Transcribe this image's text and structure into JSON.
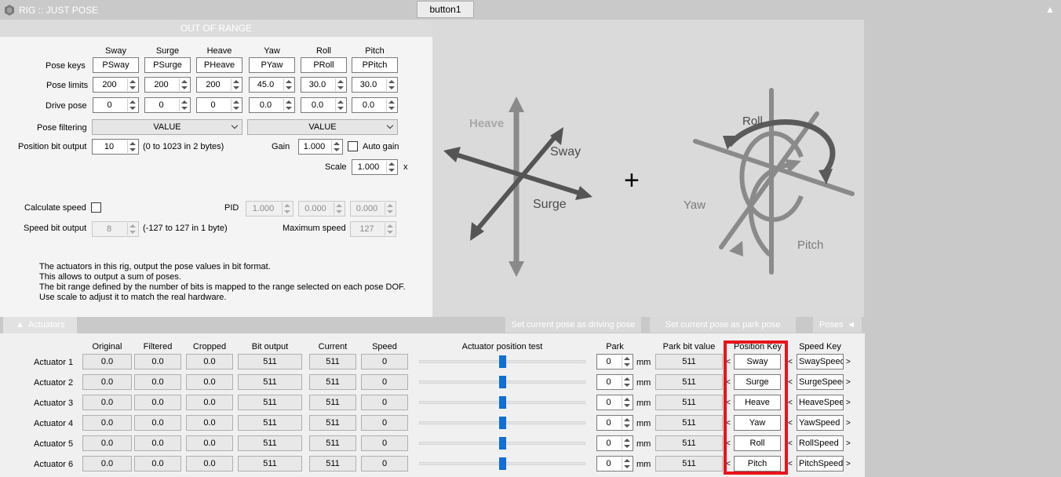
{
  "window": {
    "title": "RIG :: JUST POSE",
    "top_button": "button1"
  },
  "left": {
    "banner": "OUT OF RANGE",
    "dof_headers": [
      "Sway",
      "Surge",
      "Heave",
      "Yaw",
      "Roll",
      "Pitch"
    ],
    "row_labels": {
      "pose_keys": "Pose keys",
      "pose_limits": "Pose limits",
      "drive_pose": "Drive pose",
      "pose_filtering": "Pose filtering",
      "position_bit_output": "Position bit output"
    },
    "pose_keys": [
      "PSway",
      "PSurge",
      "PHeave",
      "PYaw",
      "PRoll",
      "PPitch"
    ],
    "pose_limits": [
      "200",
      "200",
      "200",
      "45.0",
      "30.0",
      "30.0"
    ],
    "drive_pose": [
      "0",
      "0",
      "0",
      "0.0",
      "0.0",
      "0.0"
    ],
    "filter_1": "VALUE",
    "filter_2": "VALUE",
    "position_bits": "10",
    "position_bits_note": "(0 to 1023 in 2 bytes)",
    "gain_label": "Gain",
    "gain": "1.000",
    "auto_gain_label": "Auto gain",
    "scale_label": "Scale",
    "scale": "1.000",
    "scale_unit": "x",
    "calc_speed_label": "Calculate speed",
    "pid_label": "PID",
    "pid": [
      "1.000",
      "0.000",
      "0.000"
    ],
    "speed_bit_label": "Speed bit output",
    "speed_bits": "8",
    "speed_bits_note": "(-127 to 127 in 1 byte)",
    "max_speed_label": "Maximum speed",
    "max_speed": "127",
    "description": [
      "The actuators in this rig, output the pose values in bit format.",
      "This allows to output a sum of poses.",
      "The bit range defined by the number of bits is mapped to the range selected on each pose DOF.",
      "Use scale to adjust it to match the real hardware."
    ]
  },
  "diagram": {
    "heave": "Heave",
    "sway": "Sway",
    "surge": "Surge",
    "plus": "+",
    "roll": "Roll",
    "yaw": "Yaw",
    "pitch": "Pitch"
  },
  "tabs": {
    "actuators": "Actuators",
    "set_driving": "Set current pose as driving pose",
    "set_park": "Set current pose as park pose",
    "poses": "Poses"
  },
  "actuators": {
    "headers": {
      "original": "Original",
      "filtered": "Filtered",
      "cropped": "Cropped",
      "bit_output": "Bit output",
      "current": "Current",
      "speed": "Speed",
      "position_test": "Actuator position test",
      "park": "Park",
      "park_bit": "Park bit value",
      "position_key": "Position Key",
      "speed_key": "Speed Key"
    },
    "unit": "mm",
    "lt": "<",
    "gt": ">",
    "rows": [
      {
        "name": "Actuator 1",
        "original": "0.0",
        "filtered": "0.0",
        "cropped": "0.0",
        "bit": "511",
        "current": "511",
        "speed": "0",
        "park": "0",
        "park_bit": "511",
        "pos_key": "Sway",
        "speed_key": "SwaySpeed",
        "slider": 0.5
      },
      {
        "name": "Actuator 2",
        "original": "0.0",
        "filtered": "0.0",
        "cropped": "0.0",
        "bit": "511",
        "current": "511",
        "speed": "0",
        "park": "0",
        "park_bit": "511",
        "pos_key": "Surge",
        "speed_key": "SurgeSpeed",
        "slider": 0.5
      },
      {
        "name": "Actuator 3",
        "original": "0.0",
        "filtered": "0.0",
        "cropped": "0.0",
        "bit": "511",
        "current": "511",
        "speed": "0",
        "park": "0",
        "park_bit": "511",
        "pos_key": "Heave",
        "speed_key": "HeaveSpeed",
        "slider": 0.5
      },
      {
        "name": "Actuator 4",
        "original": "0.0",
        "filtered": "0.0",
        "cropped": "0.0",
        "bit": "511",
        "current": "511",
        "speed": "0",
        "park": "0",
        "park_bit": "511",
        "pos_key": "Yaw",
        "speed_key": "YawSpeed",
        "slider": 0.5
      },
      {
        "name": "Actuator 5",
        "original": "0.0",
        "filtered": "0.0",
        "cropped": "0.0",
        "bit": "511",
        "current": "511",
        "speed": "0",
        "park": "0",
        "park_bit": "511",
        "pos_key": "Roll",
        "speed_key": "RollSpeed",
        "slider": 0.5
      },
      {
        "name": "Actuator 6",
        "original": "0.0",
        "filtered": "0.0",
        "cropped": "0.0",
        "bit": "511",
        "current": "511",
        "speed": "0",
        "park": "0",
        "park_bit": "511",
        "pos_key": "Pitch",
        "speed_key": "PitchSpeed",
        "slider": 0.5
      }
    ]
  },
  "colors": {
    "highlight": "#e8131b",
    "slider_thumb": "#0f6fd6"
  }
}
